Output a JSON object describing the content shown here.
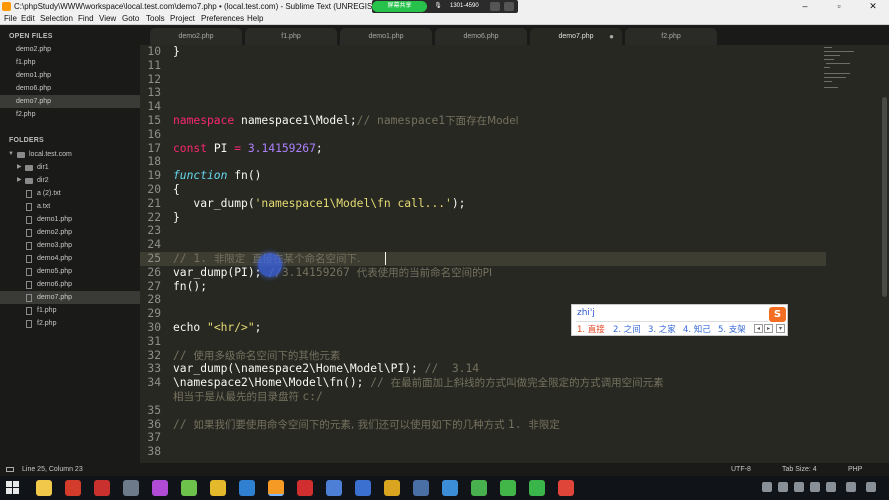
{
  "window": {
    "title": "C:\\phpStudy\\WWW\\workspace\\local.test.com\\demo7.php • (local.test.com) - Sublime Text (UNREGISTERED)",
    "share_badge": "屏幕共享",
    "share_id": "1301-4590",
    "controls": [
      "–",
      "▫",
      "✕"
    ]
  },
  "menu": [
    "File",
    "Edit",
    "Selection",
    "Find",
    "View",
    "Goto",
    "Tools",
    "Project",
    "Preferences",
    "Help"
  ],
  "sidebar": {
    "open_files_heading": "OPEN FILES",
    "open_files": [
      "demo2.php",
      "f1.php",
      "demo1.php",
      "demo6.php",
      "demo7.php",
      "f2.php"
    ],
    "folders_heading": "FOLDERS",
    "folder_root": "local.test.com",
    "folder_items": [
      {
        "label": "dir1",
        "kind": "folder"
      },
      {
        "label": "dir2",
        "kind": "folder"
      },
      {
        "label": "a (2).txt",
        "kind": "file"
      },
      {
        "label": "a.txt",
        "kind": "file"
      },
      {
        "label": "demo1.php",
        "kind": "file"
      },
      {
        "label": "demo2.php",
        "kind": "file"
      },
      {
        "label": "demo3.php",
        "kind": "file"
      },
      {
        "label": "demo4.php",
        "kind": "file"
      },
      {
        "label": "demo5.php",
        "kind": "file"
      },
      {
        "label": "demo6.php",
        "kind": "file"
      },
      {
        "label": "demo7.php",
        "kind": "file"
      },
      {
        "label": "f1.php",
        "kind": "file"
      },
      {
        "label": "f2.php",
        "kind": "file"
      }
    ]
  },
  "tabs": [
    {
      "label": "demo2.php",
      "active": false
    },
    {
      "label": "f1.php",
      "active": false
    },
    {
      "label": "demo1.php",
      "active": false
    },
    {
      "label": "demo6.php",
      "active": false
    },
    {
      "label": "demo7.php",
      "active": true,
      "modified_dot": "●"
    },
    {
      "label": "f2.php",
      "active": false
    }
  ],
  "editor": {
    "lines": [
      {
        "n": "10",
        "parts": [
          [
            "p",
            "}"
          ]
        ]
      },
      {
        "n": "11",
        "parts": []
      },
      {
        "n": "12",
        "parts": []
      },
      {
        "n": "13",
        "parts": []
      },
      {
        "n": "14",
        "parts": []
      },
      {
        "n": "15",
        "parts": [
          [
            "kw",
            "namespace"
          ],
          [
            "p",
            " namespace1\\Model;"
          ],
          [
            "cm",
            "// namespace1"
          ],
          [
            "cmc",
            "下面存在Model"
          ]
        ]
      },
      {
        "n": "16",
        "parts": []
      },
      {
        "n": "17",
        "parts": [
          [
            "kw",
            "const"
          ],
          [
            "p",
            " PI "
          ],
          [
            "kw",
            "="
          ],
          [
            "p",
            " "
          ],
          [
            "num",
            "3.14159267"
          ],
          [
            "p",
            ";"
          ]
        ]
      },
      {
        "n": "18",
        "parts": []
      },
      {
        "n": "19",
        "parts": [
          [
            "fn",
            "function"
          ],
          [
            "p",
            " fn()"
          ]
        ]
      },
      {
        "n": "20",
        "parts": [
          [
            "p",
            "{"
          ]
        ]
      },
      {
        "n": "21",
        "parts": [
          [
            "p",
            "   var_dump("
          ],
          [
            "str",
            "'namespace1\\Model\\fn call...'"
          ],
          [
            "p",
            ");"
          ]
        ]
      },
      {
        "n": "22",
        "parts": [
          [
            "p",
            "}"
          ]
        ]
      },
      {
        "n": "23",
        "parts": []
      },
      {
        "n": "24",
        "parts": []
      },
      {
        "n": "25",
        "parts": [
          [
            "cm",
            "// 1. "
          ],
          [
            "cmc",
            "非限定  直接在某个命名空间下."
          ]
        ],
        "current": true
      },
      {
        "n": "26",
        "parts": [
          [
            "p",
            "var_dump(PI); "
          ],
          [
            "cm",
            "//3.14159267 "
          ],
          [
            "cmc",
            "代表使用的当前命名空间的PI"
          ]
        ]
      },
      {
        "n": "27",
        "parts": [
          [
            "p",
            "fn();"
          ]
        ]
      },
      {
        "n": "28",
        "parts": []
      },
      {
        "n": "29",
        "parts": []
      },
      {
        "n": "30",
        "parts": [
          [
            "p",
            "echo "
          ],
          [
            "str",
            "\"<hr/>\""
          ],
          [
            "p",
            ";"
          ]
        ]
      },
      {
        "n": "31",
        "parts": []
      },
      {
        "n": "32",
        "parts": [
          [
            "cm",
            "// "
          ],
          [
            "cmc",
            "使用多级命名空间下的其他元素"
          ]
        ]
      },
      {
        "n": "33",
        "parts": [
          [
            "p",
            "var_dump(\\namespace2\\Home\\Model\\PI); "
          ],
          [
            "cm",
            "//  3.14"
          ]
        ]
      },
      {
        "n": "34",
        "parts": [
          [
            "p",
            "\\namespace2\\Home\\Model\\fn(); "
          ],
          [
            "cm",
            "// "
          ],
          [
            "cmc",
            "在最前面加上斜线的方式叫做完全限定的方式调用空间元素"
          ]
        ]
      },
      {
        "n": "",
        "parts": [
          [
            "cmc",
            "相当于是从最先的目录盘符 "
          ],
          [
            "cm",
            "c:/"
          ]
        ]
      },
      {
        "n": "35",
        "parts": []
      },
      {
        "n": "36",
        "parts": [
          [
            "cm",
            "// "
          ],
          [
            "cmc",
            "如果我们要使用命令空间下的元素, 我们还可以使用如下的几种方式 "
          ],
          [
            "cm",
            "1. "
          ],
          [
            "cmc",
            "非限定"
          ]
        ]
      },
      {
        "n": "37",
        "parts": []
      },
      {
        "n": "38",
        "parts": []
      }
    ]
  },
  "ime": {
    "pinyin": "zhi'j",
    "candidates": [
      "1. 直接",
      "2. 之间",
      "3. 之家",
      "4. 知己",
      "5. 支架"
    ],
    "logo": "S",
    "prev": "◂",
    "next": "▸",
    "more": "▾"
  },
  "status": {
    "position": "Line 25, Column 23",
    "encoding": "UTF-8",
    "tab_size": "Tab Size: 4",
    "syntax": "PHP"
  },
  "colors": {
    "editor_bg": "#272822",
    "keyword": "#f92672",
    "function": "#66d9ef",
    "number": "#ae81ff",
    "string": "#e6db74",
    "comment": "#75715e"
  },
  "taskbar_icons": [
    {
      "name": "explorer-icon",
      "color": "#f2c84b"
    },
    {
      "name": "chrome-red-icon",
      "color": "#d33c2a"
    },
    {
      "name": "app-icon-a",
      "color": "#c8312d"
    },
    {
      "name": "app-icon-b",
      "color": "#6d7a8a"
    },
    {
      "name": "app-icon-c",
      "color": "#b24bd6"
    },
    {
      "name": "app-icon-d",
      "color": "#6cc24a"
    },
    {
      "name": "chrome-icon",
      "color": "#e5b92c"
    },
    {
      "name": "vscode-icon",
      "color": "#2f80d1"
    },
    {
      "name": "sublime-icon",
      "color": "#f49a25"
    },
    {
      "name": "xmind-icon",
      "color": "#d12f2f"
    },
    {
      "name": "app-icon-e",
      "color": "#4d7fd6"
    },
    {
      "name": "app-icon-f",
      "color": "#3b6fd0"
    },
    {
      "name": "app-icon-g",
      "color": "#d9a520"
    },
    {
      "name": "app-icon-h",
      "color": "#4a6fa5"
    },
    {
      "name": "app-icon-i",
      "color": "#3c8ed8"
    },
    {
      "name": "app-icon-j",
      "color": "#48b04c"
    },
    {
      "name": "app-icon-k",
      "color": "#43b649"
    },
    {
      "name": "app-icon-l",
      "color": "#39b54a"
    },
    {
      "name": "app-icon-m",
      "color": "#e0453a"
    }
  ]
}
